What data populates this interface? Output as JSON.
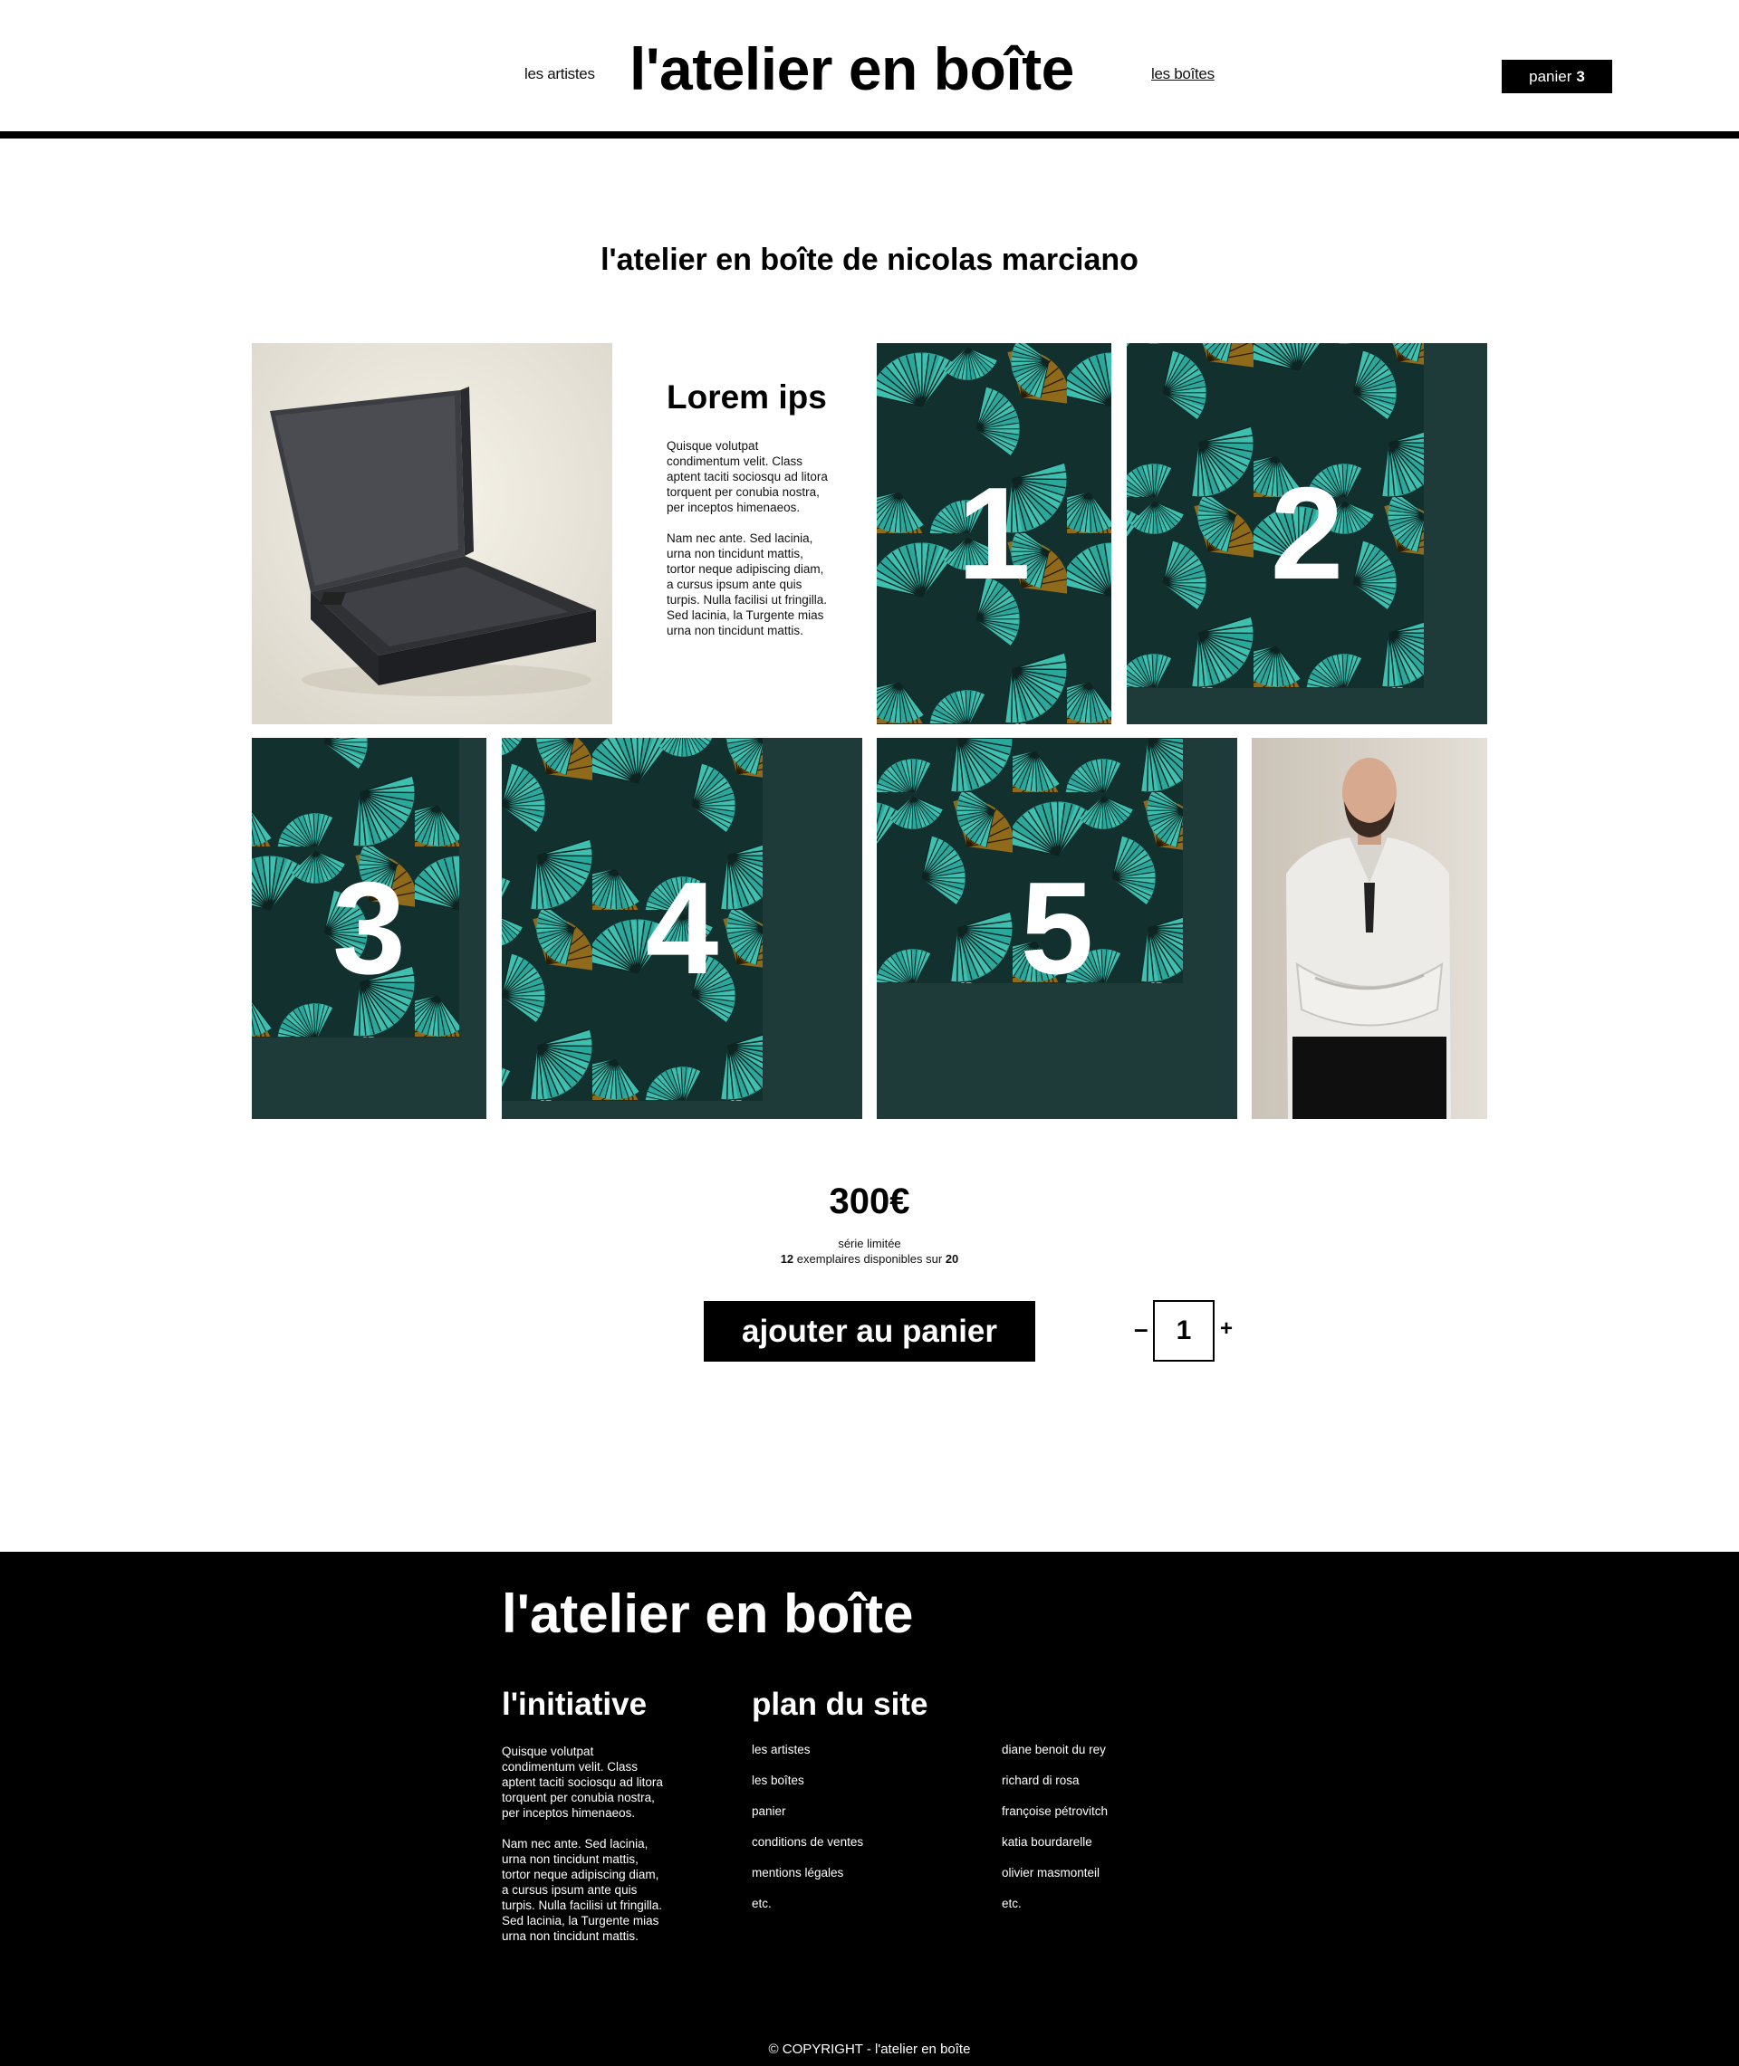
{
  "header": {
    "nav_left": "les artistes",
    "brand": "l'atelier en boîte",
    "nav_right": "les boîtes",
    "cart_label": "panier",
    "cart_count": "3"
  },
  "page_title": "l'atelier en boîte de nicolas marciano",
  "intro": {
    "heading": "Lorem ips",
    "paragraphs": [
      "Quisque volutpat condimentum velit. Class aptent taciti sociosqu ad litora torquent per conubia nostra, per inceptos himenaeos.",
      "Nam nec ante. Sed lacinia, urna non tincidunt mattis, tortor neque adipiscing diam, a cursus ipsum ante quis turpis. Nulla facilisi ut fringilla. Sed lacinia, la Turgente mias urna non tincidunt mattis."
    ]
  },
  "gallery": {
    "tiles": [
      "1",
      "2",
      "3",
      "4",
      "5"
    ]
  },
  "colors": {
    "fan_teal": "#2fb3a6",
    "fan_gold": "#9a7420",
    "fan_dark": "#12302e"
  },
  "product": {
    "price": "300€",
    "edition": "série limitée",
    "available_count": "12",
    "available_text": "exemplaires disponibles sur",
    "total_count": "20",
    "add_to_cart": "ajouter au panier",
    "qty_minus": "–",
    "qty_value": "1",
    "qty_plus": "+"
  },
  "footer": {
    "brand": "l'atelier en boîte",
    "initiative_heading": "l'initiative",
    "initiative_paragraphs": [
      "Quisque volutpat condimentum velit. Class aptent taciti sociosqu ad litora torquent per conubia nostra, per inceptos himenaeos.",
      "Nam nec ante. Sed lacinia, urna non tincidunt mattis, tortor neque adipiscing diam, a cursus ipsum ante quis turpis. Nulla facilisi ut fringilla. Sed lacinia, la Turgente mias urna non tincidunt mattis."
    ],
    "sitemap_heading": "plan du site",
    "sitemap_col1": [
      "les artistes",
      "les boîtes",
      "panier",
      "conditions de ventes",
      "mentions légales",
      "etc."
    ],
    "sitemap_col2": [
      "diane benoit du rey",
      "richard di rosa",
      "françoise pétrovitch",
      "katia bourdarelle",
      "olivier masmonteil",
      "etc."
    ],
    "copyright": "© COPYRIGHT - l'atelier en boîte"
  }
}
